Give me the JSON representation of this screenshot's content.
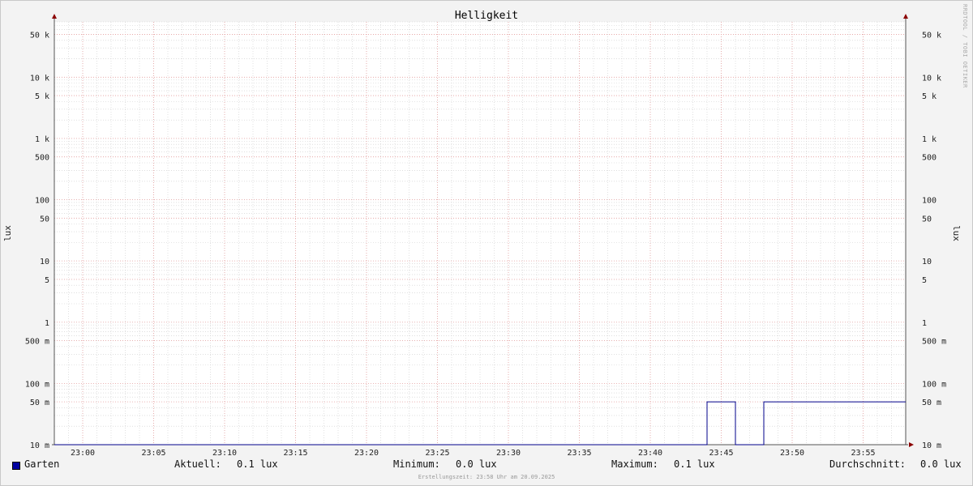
{
  "chart_data": {
    "type": "line",
    "title": "Helligkeit",
    "ylabel": "lux",
    "y_scale": "log",
    "ylim": [
      0.01,
      80000
    ],
    "x_time_range": [
      "22:58",
      "23:58"
    ],
    "x_ticks": [
      "23:00",
      "23:05",
      "23:10",
      "23:15",
      "23:20",
      "23:25",
      "23:30",
      "23:35",
      "23:40",
      "23:45",
      "23:50",
      "23:55"
    ],
    "y_ticks": [
      {
        "value": 50000,
        "label": "50 k"
      },
      {
        "value": 10000,
        "label": "10 k"
      },
      {
        "value": 5000,
        "label": "5 k"
      },
      {
        "value": 1000,
        "label": "1 k"
      },
      {
        "value": 500,
        "label": "500"
      },
      {
        "value": 100,
        "label": "100"
      },
      {
        "value": 50,
        "label": "50"
      },
      {
        "value": 10,
        "label": "10"
      },
      {
        "value": 5,
        "label": "5"
      },
      {
        "value": 1,
        "label": "1"
      },
      {
        "value": 0.5,
        "label": "500 m"
      },
      {
        "value": 0.1,
        "label": "100 m"
      },
      {
        "value": 0.05,
        "label": "50 m"
      },
      {
        "value": 0.01,
        "label": "10 m"
      }
    ],
    "grid": true,
    "series": [
      {
        "name": "Garten",
        "color": "#00008b",
        "points": [
          [
            "22:58",
            0.01
          ],
          [
            "23:44",
            0.01
          ],
          [
            "23:44",
            0.05
          ],
          [
            "23:46",
            0.05
          ],
          [
            "23:46",
            0.01
          ],
          [
            "23:48",
            0.01
          ],
          [
            "23:48",
            0.05
          ],
          [
            "23:58",
            0.05
          ]
        ]
      }
    ]
  },
  "watermark": "RRDTOOL / TOBI OETIKER",
  "legend": {
    "series_name": "Garten",
    "swatch_color": "#0000a0",
    "current_label": "Aktuell:",
    "current_value": "0.1 lux",
    "min_label": "Minimum:",
    "min_value": "0.0 lux",
    "max_label": "Maximum:",
    "max_value": "0.1 lux",
    "avg_label": "Durchschnitt:",
    "avg_value": "0.0 lux"
  },
  "footer": "Erstellungszeit: 23:58 Uhr am 20.09.2025",
  "colors": {
    "background": "#f3f3f3",
    "plot": "#ffffff",
    "major_grid": "#e8a0a0",
    "minor_grid": "#cccccc",
    "axis": "#555555",
    "arrow": "#8b0000"
  }
}
